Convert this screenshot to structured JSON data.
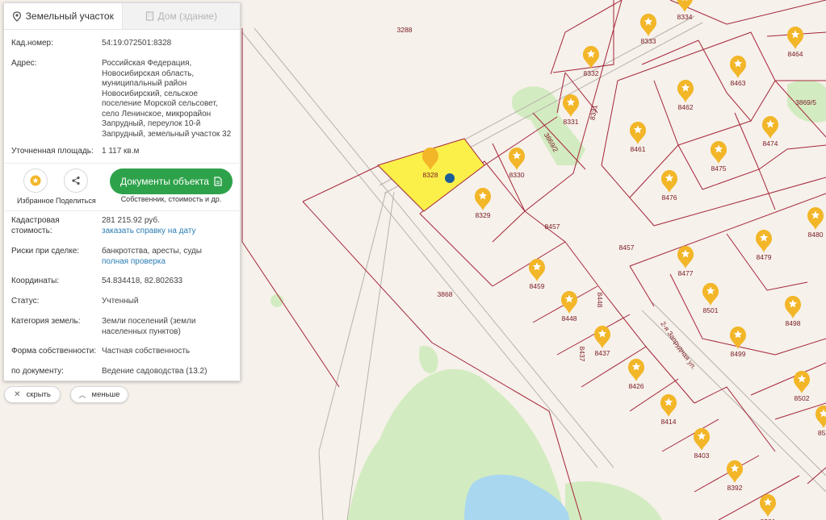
{
  "tabs": [
    {
      "label": "Земельный участок",
      "icon": "map-pin-icon",
      "active": true
    },
    {
      "label": "Дом (здание)",
      "icon": "building-icon",
      "active": false
    }
  ],
  "fields": {
    "cad_number": {
      "label": "Кад.номер:",
      "value": "54:19:072501:8328"
    },
    "address": {
      "label": "Адрес:",
      "lines": [
        "Российская Федерация,",
        "Новосибирская область,",
        "муниципальный район",
        "Новосибирский, сельское",
        "поселение Морской сельсовет,",
        "село Ленинское, микрорайон",
        "Запрудный, переулок 10-й",
        "Запрудный, земельный участок 32"
      ]
    },
    "area": {
      "label": "Уточненная площадь:",
      "value": "1 117 кв.м"
    }
  },
  "actions": {
    "favorite": {
      "label": "Избранное",
      "icon": "star-icon"
    },
    "share": {
      "label": "Поделиться",
      "icon": "share-icon"
    },
    "documents": {
      "label": "Документы объекта",
      "sub": "Собственник, стоимость и др.",
      "icon": "document-icon",
      "color": "#2ea24a"
    }
  },
  "details": {
    "cad_value": {
      "label_l1": "Кадастровая",
      "label_l2": "стоимость:",
      "value": "281 215.92 руб.",
      "link": "заказать справку на дату"
    },
    "risks": {
      "label": "Риски при сделке:",
      "value": "банкротства, аресты, суды",
      "link": "полная проверка"
    },
    "coords": {
      "label": "Координаты:",
      "value": "54.834418, 82.802633"
    },
    "status": {
      "label": "Статус:",
      "value": "Учтенный"
    },
    "category": {
      "label": "Категория земель:",
      "line1": "Земли поселений (земли",
      "line2": "населенных пунктов)"
    },
    "ownership": {
      "label": "Форма собственности:",
      "value": "Частная собственность"
    },
    "by_doc": {
      "label": "по документу:",
      "value": "Ведение садоводства (13.2)"
    }
  },
  "buttons": {
    "hide": {
      "label": "скрыть",
      "icon": "close-icon"
    },
    "less": {
      "label": "меньше",
      "icon": "chevron-up-icon"
    }
  },
  "map": {
    "colors": {
      "boundary": "#a5253a",
      "selected_fill": "#fbf04a",
      "green": "#d3ebc1",
      "water": "#a9d7f0",
      "marker": "#f2b628",
      "dot": "#1c5e9a"
    },
    "selected_parcel": "8328",
    "street": "2-я Запрудная ул.",
    "area_labels": [
      "3288",
      "3868",
      "8457",
      "8457",
      "8448",
      "8437",
      "8331",
      "3869/2",
      "3869/5"
    ],
    "parcels": [
      "8334",
      "8333",
      "8332",
      "8464",
      "8463",
      "8462",
      "8331",
      "8461",
      "8474",
      "8475",
      "8476",
      "8330",
      "8329",
      "8480",
      "8479",
      "8477",
      "8459",
      "8501",
      "8498",
      "8448",
      "8437",
      "8499",
      "8426",
      "8502",
      "8414",
      "8403",
      "8392",
      "8381",
      "852"
    ]
  }
}
